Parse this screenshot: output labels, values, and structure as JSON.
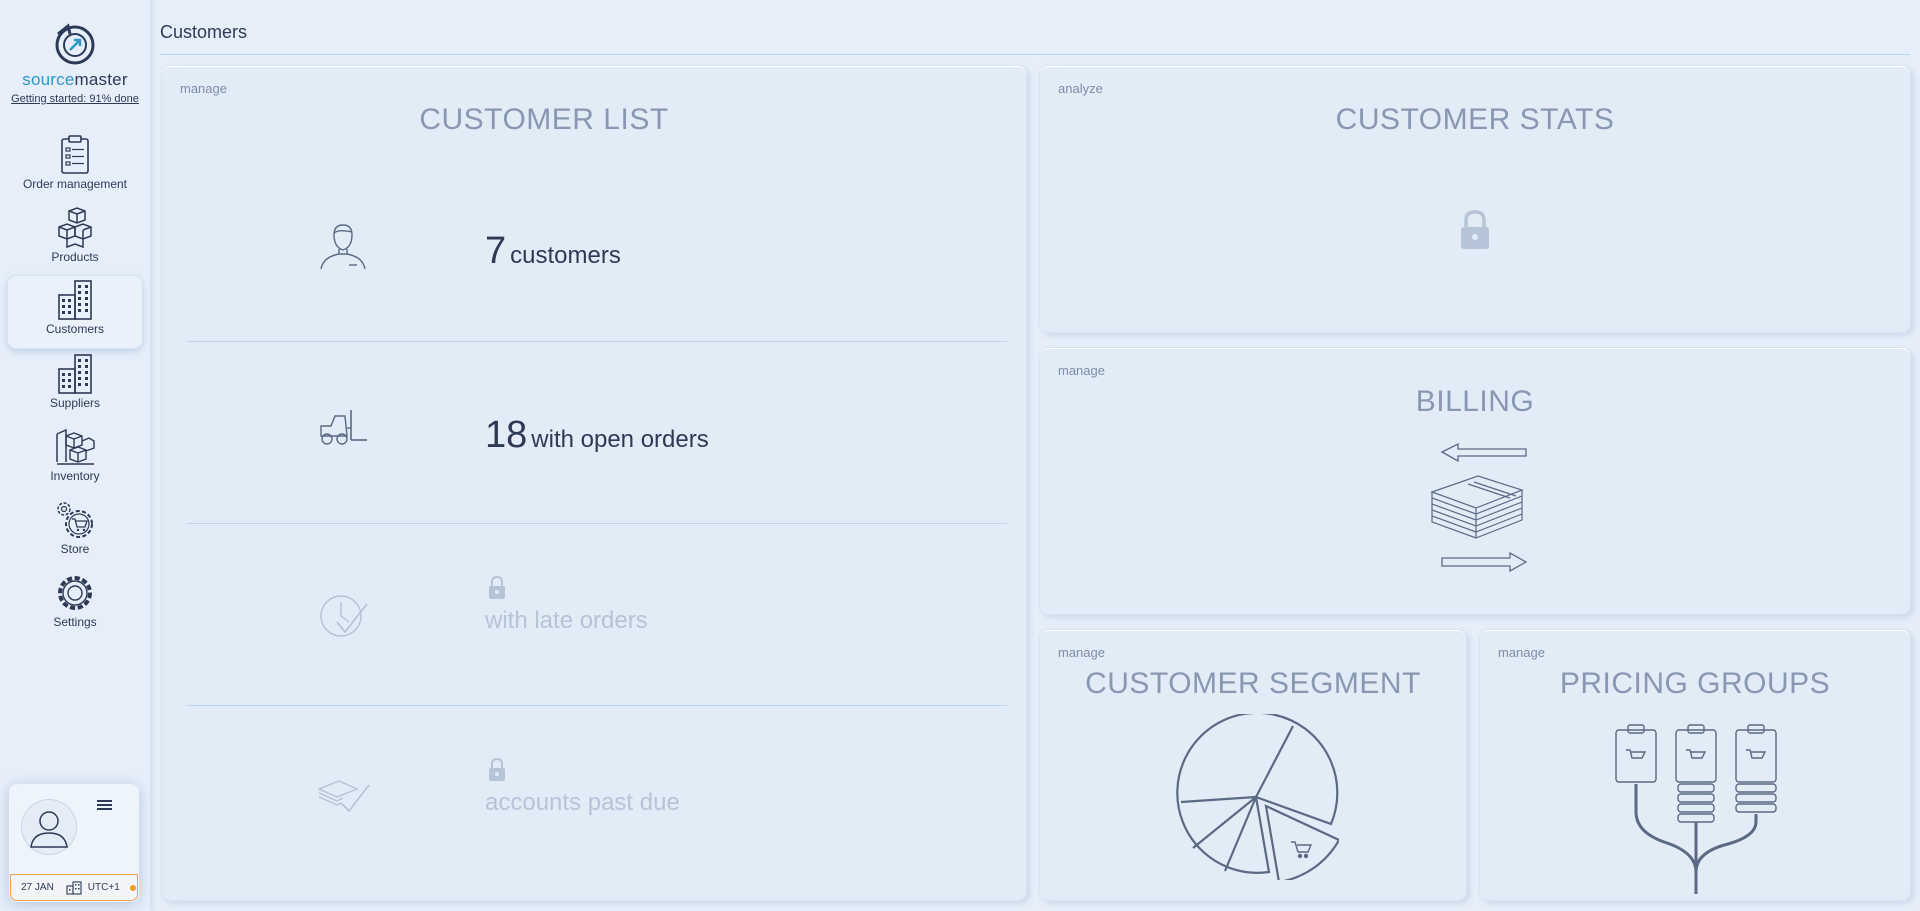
{
  "app": {
    "logo_part1": "source",
    "logo_part2": "master",
    "getting_started": "Getting started: 91% done"
  },
  "sidebar": {
    "items": [
      {
        "label": "Order management",
        "icon": "clipboard-icon"
      },
      {
        "label": "Products",
        "icon": "boxes-icon"
      },
      {
        "label": "Customers",
        "icon": "buildings-icon",
        "active": true
      },
      {
        "label": "Suppliers",
        "icon": "buildings-icon"
      },
      {
        "label": "Inventory",
        "icon": "warehouse-boxes-icon"
      },
      {
        "label": "Store",
        "icon": "store-gear-cart-icon"
      },
      {
        "label": "Settings",
        "icon": "gear-icon"
      }
    ]
  },
  "user": {
    "date": "27 JAN",
    "timezone": "UTC+1"
  },
  "page": {
    "title": "Customers"
  },
  "panels": {
    "customer_list": {
      "tag": "manage",
      "title": "CUSTOMER LIST",
      "rows": [
        {
          "count": "7",
          "label": "customers",
          "locked": false,
          "icon": "person-icon"
        },
        {
          "count": "18",
          "label": "with open orders",
          "locked": false,
          "icon": "forklift-icon"
        },
        {
          "count": "",
          "label": "with late orders",
          "locked": true,
          "icon": "clock-check-icon"
        },
        {
          "count": "",
          "label": "accounts past due",
          "locked": true,
          "icon": "money-check-icon"
        }
      ]
    },
    "customer_stats": {
      "tag": "analyze",
      "title": "CUSTOMER STATS",
      "locked": true
    },
    "billing": {
      "tag": "manage",
      "title": "BILLING"
    },
    "customer_segment": {
      "tag": "manage",
      "title": "CUSTOMER SEGMENT"
    },
    "pricing_groups": {
      "tag": "manage",
      "title": "PRICING GROUPS"
    }
  },
  "colors": {
    "background": "#e6eff9",
    "accent": "#2b98c9",
    "text_dark": "#2d3a55",
    "title_muted": "#8898b2",
    "status_border": "#f0a25a"
  }
}
